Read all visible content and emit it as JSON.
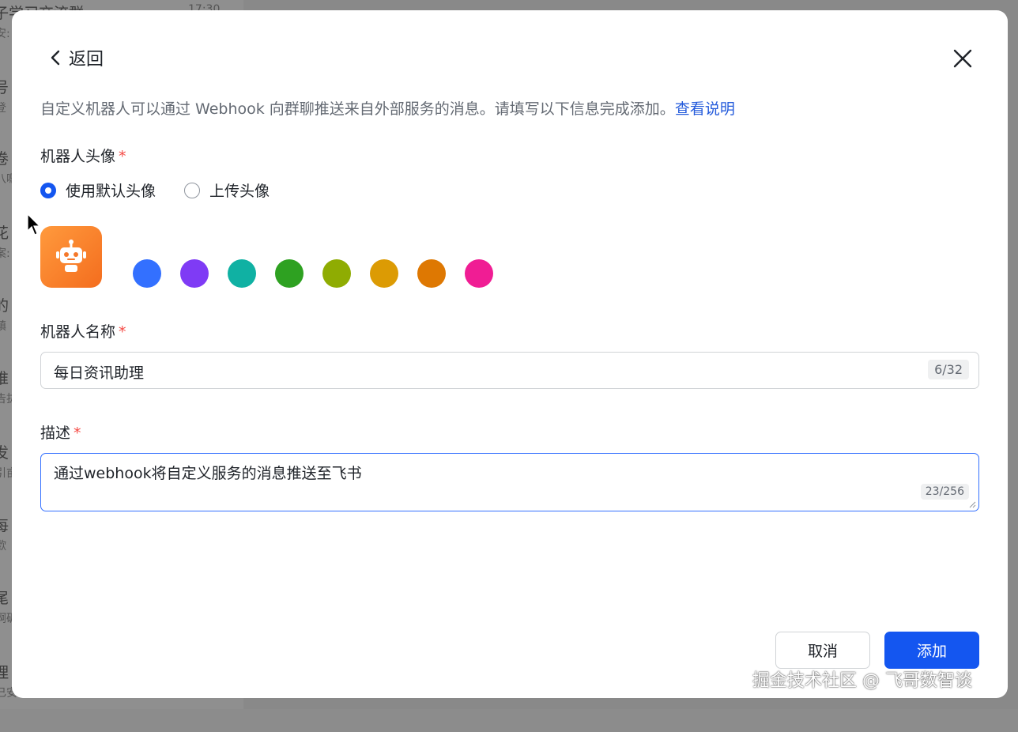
{
  "background": {
    "items": [
      {
        "title": "子学习交流群",
        "sub": "安:",
        "time": "17:30"
      },
      {
        "title": "号",
        "sub": "登",
        "time": ""
      },
      {
        "title": "卷",
        "sub": "八嗯",
        "time": ""
      },
      {
        "title": "花",
        "sub": "案:",
        "time": ""
      },
      {
        "title": "的",
        "sub": "镇",
        "time": ""
      },
      {
        "title": "推",
        "sub": "告拔",
        "time": ""
      },
      {
        "title": "发",
        "sub": "引亩",
        "time": ""
      },
      {
        "title": "每",
        "sub": "歡",
        "time": ""
      },
      {
        "title": "尾",
        "sub": "啊砺",
        "time": ""
      },
      {
        "title": "理",
        "sub": "已安装由子",
        "time": ""
      }
    ]
  },
  "dialog": {
    "back_label": "返回",
    "intro_text": "自定义机器人可以通过 Webhook 向群聊推送来自外部服务的消息。请填写以下信息完成添加。",
    "intro_link": "查看说明",
    "avatar_section": {
      "label": "机器人头像",
      "required_mark": "*",
      "options": [
        {
          "label": "使用默认头像",
          "selected": true
        },
        {
          "label": "上传头像",
          "selected": false
        }
      ],
      "avatar_icon": "robot-icon",
      "avatar_color": "#f5782a",
      "swatches": [
        "#3370ff",
        "#7f3bf5",
        "#10b1a3",
        "#2ea121",
        "#8fac02",
        "#dc9b04",
        "#de7802",
        "#f01d94"
      ]
    },
    "name_section": {
      "label": "机器人名称",
      "required_mark": "*",
      "value": "每日资讯助理",
      "count": "6/32"
    },
    "desc_section": {
      "label": "描述",
      "required_mark": "*",
      "value": "通过webhook将自定义服务的消息推送至飞书",
      "count": "23/256"
    },
    "cancel_label": "取消",
    "add_label": "添加"
  },
  "watermark": "掘金技术社区 @ 飞哥数智谈"
}
